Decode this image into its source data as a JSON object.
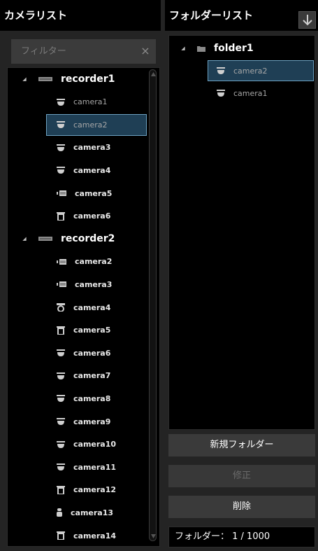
{
  "left_panel": {
    "title": "カメラリスト",
    "filter_placeholder": "フィルター",
    "filter_value": "",
    "clear_icon": "×"
  },
  "right_panel": {
    "title": "フォルダーリスト",
    "download_icon": "download-arrow-icon"
  },
  "camera_tree": [
    {
      "type": "recorder",
      "label": "recorder1",
      "icon": "recorder-icon",
      "expanded": true
    },
    {
      "type": "camera",
      "label": "camera1",
      "icon": "dome-camera-icon",
      "dim": true
    },
    {
      "type": "camera",
      "label": "camera2",
      "icon": "dome-camera-icon",
      "dim": true,
      "selected": true
    },
    {
      "type": "camera",
      "label": "camera3",
      "icon": "dome-camera-icon"
    },
    {
      "type": "camera",
      "label": "camera4",
      "icon": "dome-camera-icon"
    },
    {
      "type": "camera",
      "label": "camera5",
      "icon": "box-camera-icon"
    },
    {
      "type": "camera",
      "label": "camera6",
      "icon": "ptz-camera-icon"
    },
    {
      "type": "recorder",
      "label": "recorder2",
      "icon": "recorder-icon",
      "expanded": true
    },
    {
      "type": "camera",
      "label": "camera2",
      "icon": "box-camera-icon"
    },
    {
      "type": "camera",
      "label": "camera3",
      "icon": "box-camera-icon"
    },
    {
      "type": "camera",
      "label": "camera4",
      "icon": "fisheye-camera-icon"
    },
    {
      "type": "camera",
      "label": "camera5",
      "icon": "ptz-camera-icon"
    },
    {
      "type": "camera",
      "label": "camera6",
      "icon": "dome-camera-icon"
    },
    {
      "type": "camera",
      "label": "camera7",
      "icon": "dome-camera-icon"
    },
    {
      "type": "camera",
      "label": "camera8",
      "icon": "dome-camera-icon"
    },
    {
      "type": "camera",
      "label": "camera9",
      "icon": "dome-camera-icon"
    },
    {
      "type": "camera",
      "label": "camera10",
      "icon": "dome-camera-icon"
    },
    {
      "type": "camera",
      "label": "camera11",
      "icon": "dome-camera-icon"
    },
    {
      "type": "camera",
      "label": "camera12",
      "icon": "ptz-camera-icon"
    },
    {
      "type": "camera",
      "label": "camera13",
      "icon": "bullet-camera-icon"
    },
    {
      "type": "camera",
      "label": "camera14",
      "icon": "ptz-camera-icon"
    }
  ],
  "folder_tree": [
    {
      "type": "folder",
      "label": "folder1",
      "icon": "folder-icon",
      "expanded": true
    },
    {
      "type": "camera",
      "label": "camera2",
      "icon": "dome-camera-icon",
      "dim": true,
      "selected": true
    },
    {
      "type": "camera",
      "label": "camera1",
      "icon": "dome-camera-icon",
      "dim": true
    }
  ],
  "buttons": {
    "new_folder": "新規フォルダー",
    "edit": "修正",
    "delete": "削除"
  },
  "folder_count": "フォルダー： 1  / 1000",
  "colors": {
    "selected_fill": "#1f3f55",
    "selected_border": "#6da2c2",
    "background": "#242424"
  }
}
